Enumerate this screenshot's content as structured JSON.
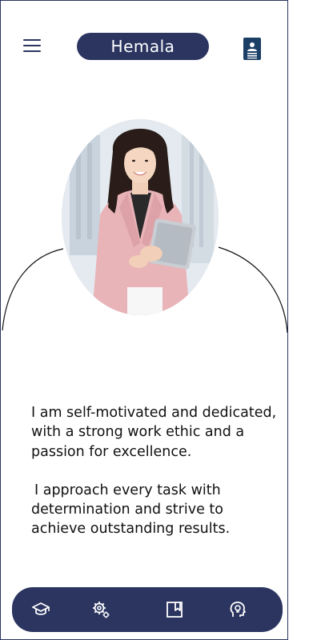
{
  "header": {
    "menu_icon": "hamburger-menu-icon",
    "title": "Hemala",
    "profile_icon": "resume-profile-icon"
  },
  "hero": {
    "image": "portrait of a smiling woman holding a tablet",
    "frame_icon": "circular-photo-frame"
  },
  "about": {
    "paragraph_1": "I am self-motivated and dedicated, with a strong work ethic and a passion for excellence.",
    "paragraph_2": "I approach every task with determination and strive to achieve outstanding results."
  },
  "bottom_nav": {
    "items": [
      {
        "icon": "graduation-cap-icon"
      },
      {
        "icon": "gear-skills-icon"
      },
      {
        "icon": "bookmark-book-icon"
      },
      {
        "icon": "lightbulb-head-icon"
      }
    ]
  },
  "colors": {
    "primary": "#2b3560",
    "background": "#ffffff",
    "text": "#111111",
    "blouse": "#e8b4b8"
  }
}
